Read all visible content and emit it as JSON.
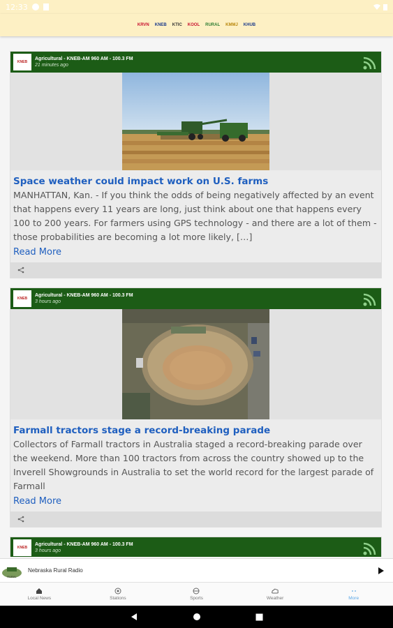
{
  "status_bar": {
    "time": "12:33"
  },
  "brand_logos": [
    "KRVN",
    "KNEB",
    "KTIC",
    "KOOL",
    "RURAL",
    "KMMJ",
    "KHUB"
  ],
  "cards": [
    {
      "source": "Agricultural - KNEB-AM 960 AM - 100.3 FM",
      "time": "21 minutes ago",
      "title": "Space weather could impact work on U.S. farms",
      "body": "MANHATTAN, Kan. - If you think the odds of being negatively affected by an event that happens every 11 years are long, just think about one that happens every 100 to 200 years.  For farmers using GPS technology - and there are a lot of them - those probabilities are becoming a lot more likely, […]",
      "read_more": "Read More"
    },
    {
      "source": "Agricultural - KNEB-AM 960 AM - 100.3 FM",
      "time": "3 hours ago",
      "title": "Farmall tractors stage a record-breaking parade",
      "body": "Collectors of Farmall tractors in Australia staged a record-breaking parade over the weekend. More than 100 tractors from across the country showed up to the Inverell Showgrounds in Australia to set the world record for the largest parade of Farmall",
      "read_more": "Read More"
    },
    {
      "source": "Agricultural - KNEB-AM 960 AM - 100.3 FM",
      "time": "3 hours ago"
    }
  ],
  "player": {
    "station": "Nebraska Rural Radio"
  },
  "tabs": [
    {
      "label": "Local News",
      "icon": "home-icon"
    },
    {
      "label": "Stations",
      "icon": "radio-icon"
    },
    {
      "label": "Sports",
      "icon": "ball-icon"
    },
    {
      "label": "Weather",
      "icon": "cloud-icon"
    },
    {
      "label": "More",
      "icon": "more-icon"
    }
  ],
  "colors": {
    "header_bg": "#fdf0c4",
    "card_header": "#1c5c16",
    "link": "#1f5fbf",
    "active_tab": "#5ba7e6"
  }
}
